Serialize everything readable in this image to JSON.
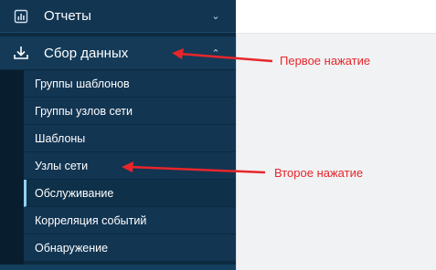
{
  "sidebar": {
    "reports": {
      "label": "Отчеты",
      "icon": "bar-chart-icon"
    },
    "collect": {
      "label": "Сбор данных",
      "icon": "download-icon"
    },
    "items": [
      {
        "label": "Группы шаблонов"
      },
      {
        "label": "Группы узлов сети"
      },
      {
        "label": "Шаблоны"
      },
      {
        "label": "Узлы сети"
      },
      {
        "label": "Обслуживание",
        "active": true
      },
      {
        "label": "Корреляция событий"
      },
      {
        "label": "Обнаружение"
      }
    ]
  },
  "annotations": {
    "first": "Первое нажатие",
    "second": "Второе нажатие",
    "color": "#e8262a"
  },
  "colors": {
    "sidebar_bg": "#0c2a40",
    "item_bg": "#123552",
    "active_marker": "#8fd0f0",
    "content_bg": "#f0f2f4"
  }
}
